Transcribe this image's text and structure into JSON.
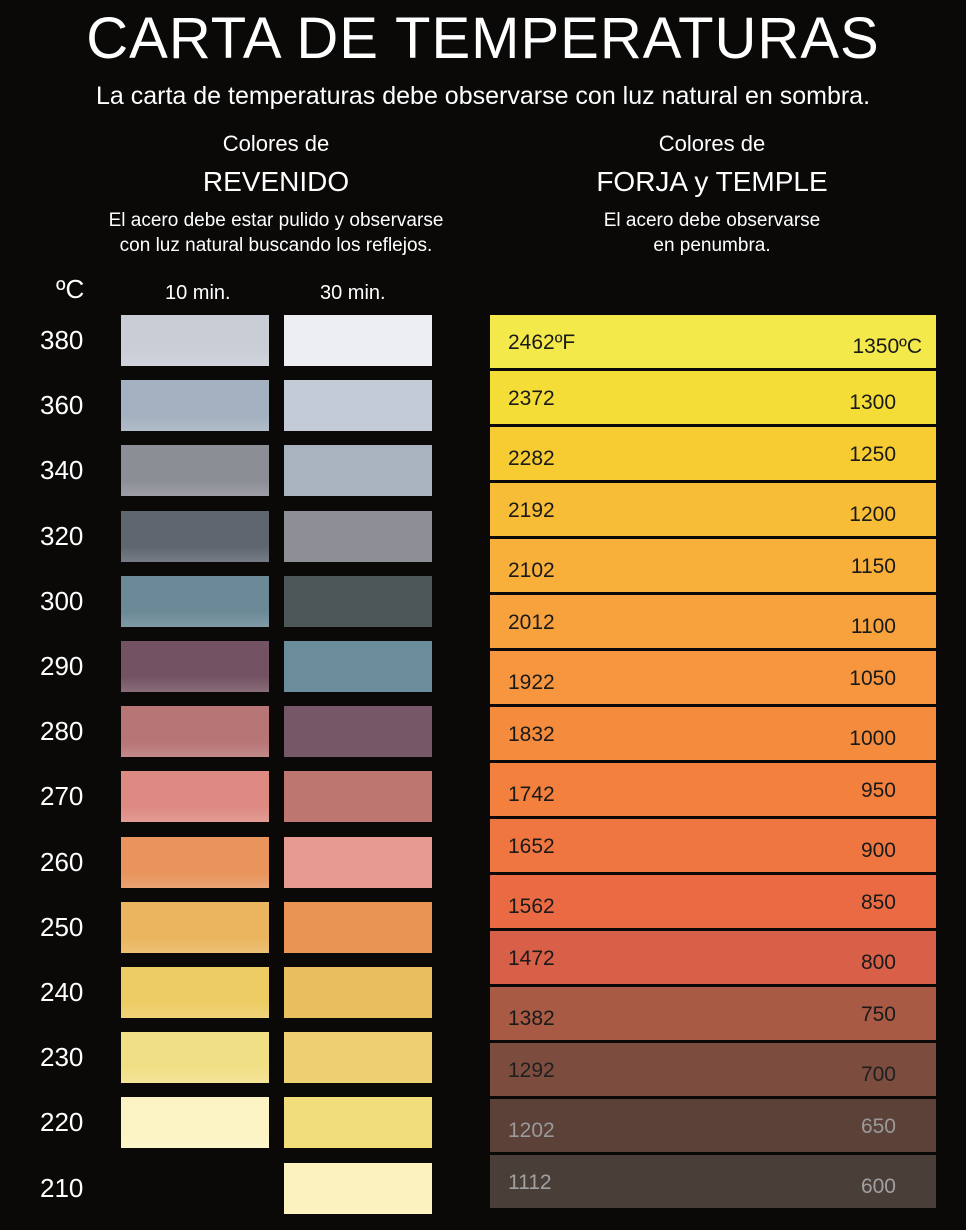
{
  "header": {
    "title": "CARTA DE TEMPERATURAS",
    "subtitle": "La carta de temperaturas debe observarse con luz natural en sombra."
  },
  "revenido": {
    "small": "Colores de",
    "big": "REVENIDO",
    "note_line1": "El acero debe estar pulido y observarse",
    "note_line2": "con luz natural buscando los reflejos.",
    "unit": "ºC",
    "col1": "10 min.",
    "col2": "30 min.",
    "rows": [
      {
        "temp": "380",
        "c10": "#c9cdd6",
        "c30": "#eceef2"
      },
      {
        "temp": "360",
        "c10": "#a3b1c0",
        "c30": "#c3cbd6"
      },
      {
        "temp": "340",
        "c10": "#8c8e96",
        "c30": "#a9b3c0"
      },
      {
        "temp": "320",
        "c10": "#5f6670",
        "c30": "#8e8e96"
      },
      {
        "temp": "300",
        "c10": "#6b8996",
        "c30": "#4d5659"
      },
      {
        "temp": "290",
        "c10": "#735363",
        "c30": "#6b8c9b"
      },
      {
        "temp": "280",
        "c10": "#b77575",
        "c30": "#765767"
      },
      {
        "temp": "270",
        "c10": "#dd8a82",
        "c30": "#bd7770"
      },
      {
        "temp": "260",
        "c10": "#e8945c",
        "c30": "#e79a92"
      },
      {
        "temp": "250",
        "c10": "#eab55e",
        "c30": "#e89455"
      },
      {
        "temp": "240",
        "c10": "#edcc64",
        "c30": "#e9be5f"
      },
      {
        "temp": "230",
        "c10": "#f1df86",
        "c30": "#eed070"
      },
      {
        "temp": "220",
        "c10": "#fbf3c3",
        "c30": "#f1de7a"
      },
      {
        "temp": "210",
        "c10": "",
        "c30": "#fbf2c0"
      }
    ]
  },
  "forja": {
    "small": "Colores de",
    "big": "FORJA y TEMPLE",
    "note_line1": "El acero debe observarse",
    "note_line2": "en penumbra.",
    "rows": [
      {
        "f": "2462ºF",
        "c": "1350ºC",
        "color": "#f4e94a",
        "text": "#1a1a1a"
      },
      {
        "f": "2372",
        "c": "1300",
        "color": "#f4dd36",
        "text": "#1a1a1a"
      },
      {
        "f": "2282",
        "c": "1250",
        "color": "#f7cc33",
        "text": "#1a1a1a"
      },
      {
        "f": "2192",
        "c": "1200",
        "color": "#f8bd36",
        "text": "#1a1a1a"
      },
      {
        "f": "2102",
        "c": "1150",
        "color": "#f8b03a",
        "text": "#1a1a1a"
      },
      {
        "f": "2012",
        "c": "1100",
        "color": "#f8a23e",
        "text": "#1a1a1a"
      },
      {
        "f": "1922",
        "c": "1050",
        "color": "#f7963e",
        "text": "#1a1a1a"
      },
      {
        "f": "1832",
        "c": "1000",
        "color": "#f58b3c",
        "text": "#1a1a1a"
      },
      {
        "f": "1742",
        "c": "950",
        "color": "#f3803c",
        "text": "#1a1a1a"
      },
      {
        "f": "1652",
        "c": "900",
        "color": "#ef7640",
        "text": "#1a1a1a"
      },
      {
        "f": "1562",
        "c": "850",
        "color": "#ea6b43",
        "text": "#1a1a1a"
      },
      {
        "f": "1472",
        "c": "800",
        "color": "#d86048",
        "text": "#1a1a1a"
      },
      {
        "f": "1382",
        "c": "750",
        "color": "#a85a44",
        "text": "#1a1a1a"
      },
      {
        "f": "1292",
        "c": "700",
        "color": "#7c4d3e",
        "text": "#1f1f1f"
      },
      {
        "f": "1202",
        "c": "650",
        "color": "#5b4138",
        "text": "#9a9a9a"
      },
      {
        "f": "1112",
        "c": "600",
        "color": "#4a3e39",
        "text": "#a0a0a0"
      }
    ]
  }
}
